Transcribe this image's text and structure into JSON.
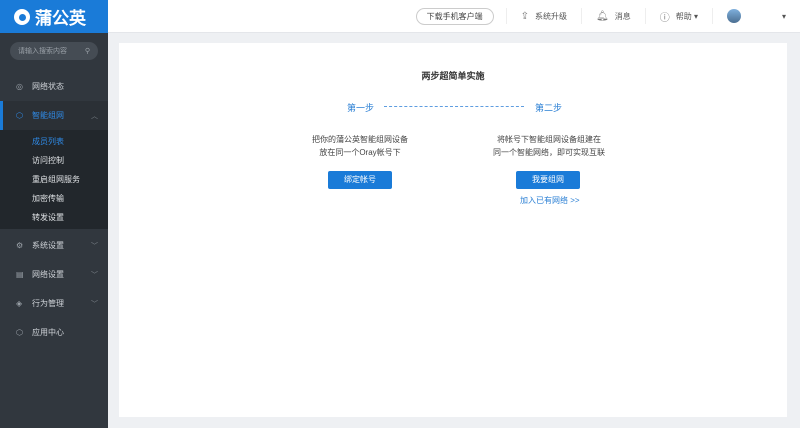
{
  "brand": {
    "name": "蒲公英",
    "color": "#1a7bd8"
  },
  "header": {
    "download": "下载手机客户端",
    "upgrade": "系统升级",
    "messages": "消息",
    "help": "帮助"
  },
  "sidebar": {
    "search_placeholder": "请输入搜索内容",
    "items": [
      {
        "label": "网络状态",
        "icon": "network-icon"
      },
      {
        "label": "智能组网",
        "icon": "cube-icon",
        "active": true,
        "children": [
          "成员列表",
          "访问控制",
          "重启组网服务",
          "加密传输",
          "转发设置"
        ]
      },
      {
        "label": "系统设置",
        "icon": "gear-icon"
      },
      {
        "label": "网络设置",
        "icon": "settings-panel-icon"
      },
      {
        "label": "行为管理",
        "icon": "shield-icon"
      },
      {
        "label": "应用中心",
        "icon": "cube-icon"
      }
    ]
  },
  "main": {
    "title": "两步超简单实施",
    "step1": {
      "label": "第一步",
      "desc1": "把你的蒲公英智能组网设备",
      "desc2": "放在同一个Oray帐号下",
      "button": "绑定帐号"
    },
    "step2": {
      "label": "第二步",
      "desc1": "将帐号下智能组网设备组建在",
      "desc2": "同一个智能网络，即可实现互联",
      "button": "我要组网",
      "link": "加入已有网络 >>"
    }
  }
}
